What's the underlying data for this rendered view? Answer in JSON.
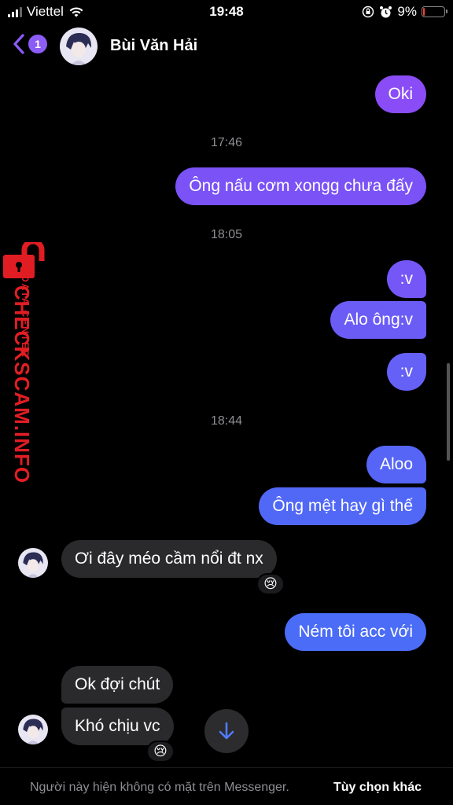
{
  "status": {
    "carrier": "Viettel",
    "time": "19:48",
    "battery_text": "9%",
    "battery_level": 0.09
  },
  "header": {
    "back_count": "1",
    "contact_name": "Bùi Văn Hải"
  },
  "messages": {
    "m1": "Oki",
    "t1": "17:46",
    "m2": "Ông nấu cơm xongg chưa đấy",
    "t2": "18:05",
    "m3": ":v",
    "m4": "Alo ông:v",
    "m5": ":v",
    "t3": "18:44",
    "m6": "Aloo",
    "m7": "Ông mệt hay gì thế",
    "m8": "Ơi đây méo cầm nổi đt nx",
    "m8_reaction": "😢",
    "m9": "Ném tôi acc với",
    "m10": "Ok đợi chút",
    "m11": "Khó chịu vc",
    "m11_reaction": "😢"
  },
  "watermark": {
    "main": "CHECKSCAM.INFO",
    "sub": "DATA CENTER"
  },
  "footer": {
    "notice": "Người này hiện không có mặt trên Messenger.",
    "action": "Tùy chọn khác"
  },
  "colors": {
    "accent": "#8b5cf6",
    "outgoing_top": "#8a4cf6",
    "outgoing_bottom": "#3f66f6",
    "incoming": "#2a2a2c",
    "watermark": "#e11d24"
  }
}
